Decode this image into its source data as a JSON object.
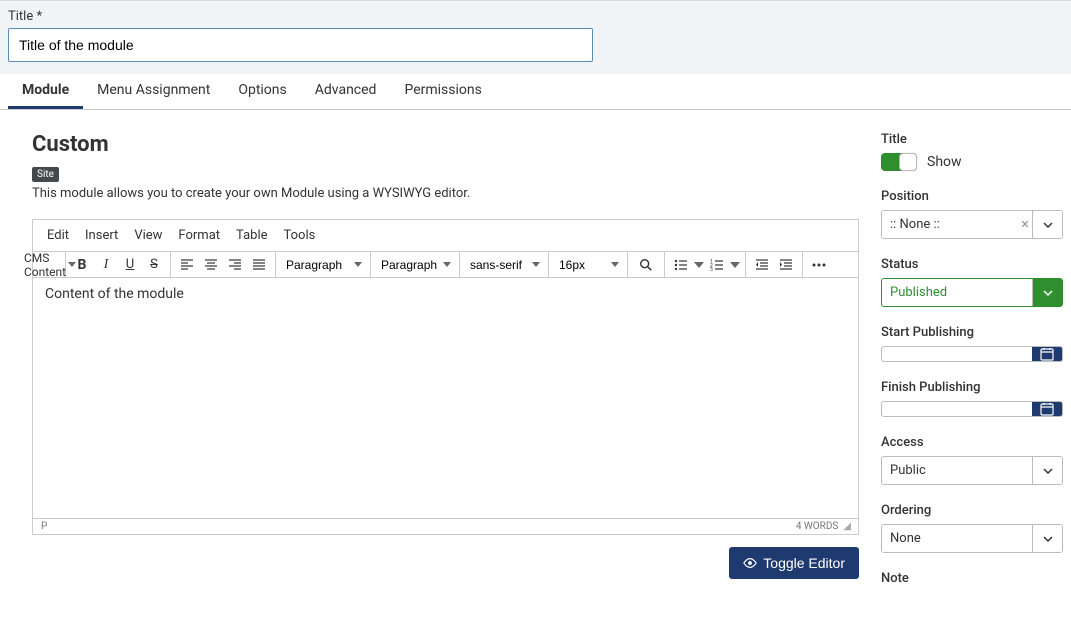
{
  "title_field": {
    "label": "Title *",
    "value": "Title of the module"
  },
  "tabs": [
    "Module",
    "Menu Assignment",
    "Options",
    "Advanced",
    "Permissions"
  ],
  "module_head": {
    "heading": "Custom",
    "badge": "Site",
    "desc": "This module allows you to create your own Module using a WYSIWYG editor."
  },
  "menubar": [
    "Edit",
    "Insert",
    "View",
    "Format",
    "Table",
    "Tools"
  ],
  "toolbar": {
    "cms_label": "CMS Content",
    "format_select": "Paragraph",
    "block_select": "Paragraph",
    "font_select": "sans-serif",
    "size_select": "16px"
  },
  "editor_content": "Content of the module",
  "statusbar": {
    "path": "P",
    "words": "4 WORDS"
  },
  "toggle_editor": "Toggle Editor",
  "side": {
    "title": {
      "label": "Title",
      "value": "Show"
    },
    "position": {
      "label": "Position",
      "value": ":: None ::"
    },
    "status": {
      "label": "Status",
      "value": "Published"
    },
    "start": {
      "label": "Start Publishing",
      "value": ""
    },
    "finish": {
      "label": "Finish Publishing",
      "value": ""
    },
    "access": {
      "label": "Access",
      "value": "Public"
    },
    "ordering": {
      "label": "Ordering",
      "value": "None"
    },
    "note": {
      "label": "Note"
    }
  }
}
